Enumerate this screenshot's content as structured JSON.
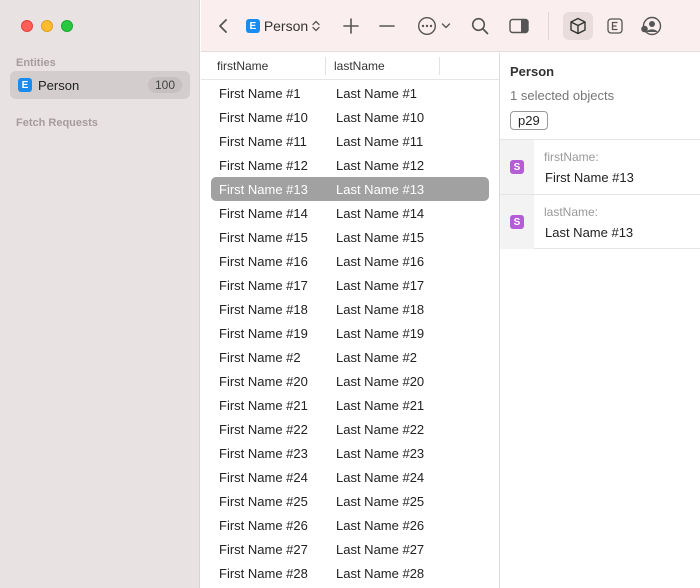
{
  "sidebar": {
    "entities_header": "Entities",
    "entities": [
      {
        "badge": "E",
        "name": "Person",
        "count": "100"
      }
    ],
    "fetch_header": "Fetch Requests"
  },
  "toolbar": {
    "entity_badge": "E",
    "entity_label": "Person",
    "icons": [
      "back-chevron",
      "add",
      "remove",
      "more-menu",
      "search",
      "toggle-inspector",
      "object-graph",
      "entity-view",
      "account"
    ]
  },
  "table": {
    "columns": [
      "firstName",
      "lastName"
    ],
    "rows": [
      [
        "First Name #1",
        "Last Name #1"
      ],
      [
        "First Name #10",
        "Last Name #10"
      ],
      [
        "First Name #11",
        "Last Name #11"
      ],
      [
        "First Name #12",
        "Last Name #12"
      ],
      [
        "First Name #13",
        "Last Name #13"
      ],
      [
        "First Name #14",
        "Last Name #14"
      ],
      [
        "First Name #15",
        "Last Name #15"
      ],
      [
        "First Name #16",
        "Last Name #16"
      ],
      [
        "First Name #17",
        "Last Name #17"
      ],
      [
        "First Name #18",
        "Last Name #18"
      ],
      [
        "First Name #19",
        "Last Name #19"
      ],
      [
        "First Name #2",
        "Last Name #2"
      ],
      [
        "First Name #20",
        "Last Name #20"
      ],
      [
        "First Name #21",
        "Last Name #21"
      ],
      [
        "First Name #22",
        "Last Name #22"
      ],
      [
        "First Name #23",
        "Last Name #23"
      ],
      [
        "First Name #24",
        "Last Name #24"
      ],
      [
        "First Name #25",
        "Last Name #25"
      ],
      [
        "First Name #26",
        "Last Name #26"
      ],
      [
        "First Name #27",
        "Last Name #27"
      ],
      [
        "First Name #28",
        "Last Name #28"
      ]
    ],
    "selected_index": 4
  },
  "inspector": {
    "title": "Person",
    "subtitle": "1 selected objects",
    "object_id": "p29",
    "attributes": [
      {
        "badge": "S",
        "name": "firstName:",
        "value": "First Name #13"
      },
      {
        "badge": "S",
        "name": "lastName:",
        "value": "Last Name #13"
      }
    ]
  },
  "colors": {
    "entity_badge": "#1a8cf0",
    "string_badge": "#b45dd6",
    "selection": "#a1a1a1",
    "sidebar_bg": "#e8e2e3",
    "toolbar_bg": "#fbeeee"
  }
}
